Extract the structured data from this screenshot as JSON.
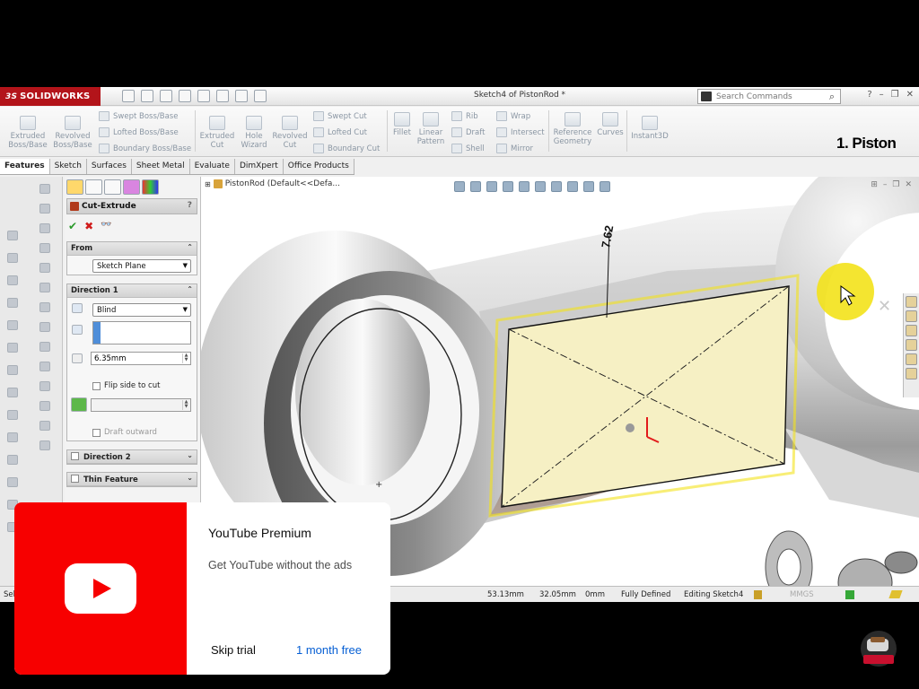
{
  "app": {
    "brand": "SOLIDWORKS",
    "brand_prefix": "3S",
    "document_title": "Sketch4 of PistonRod *",
    "search_placeholder": "Search Commands"
  },
  "ribbon": {
    "buttons": [
      {
        "label": "Extruded Boss/Base"
      },
      {
        "label": "Revolved Boss/Base"
      },
      {
        "label": "Extruded Cut"
      },
      {
        "label": "Hole Wizard"
      },
      {
        "label": "Revolved Cut"
      },
      {
        "label": "Fillet"
      },
      {
        "label": "Linear Pattern"
      },
      {
        "label": "Reference Geometry"
      },
      {
        "label": "Curves"
      },
      {
        "label": "Instant3D"
      }
    ],
    "small": [
      {
        "label": "Swept Boss/Base"
      },
      {
        "label": "Lofted Boss/Base"
      },
      {
        "label": "Boundary Boss/Base"
      },
      {
        "label": "Swept Cut"
      },
      {
        "label": "Lofted Cut"
      },
      {
        "label": "Boundary Cut"
      },
      {
        "label": "Rib"
      },
      {
        "label": "Draft"
      },
      {
        "label": "Shell"
      },
      {
        "label": "Wrap"
      },
      {
        "label": "Intersect"
      },
      {
        "label": "Mirror"
      }
    ],
    "overlay_title": "1. Piston"
  },
  "tabs": [
    "Features",
    "Sketch",
    "Surfaces",
    "Sheet Metal",
    "Evaluate",
    "DimXpert",
    "Office Products"
  ],
  "property_manager": {
    "title": "Cut-Extrude",
    "help": "?",
    "from": {
      "header": "From",
      "value": "Sketch Plane"
    },
    "direction1": {
      "header": "Direction 1",
      "end_condition": "Blind",
      "depth": "6.35mm",
      "flip_side": "Flip side to cut",
      "draft_outward": "Draft outward"
    },
    "direction2": {
      "header": "Direction 2"
    },
    "thin_feature": {
      "header": "Thin Feature"
    }
  },
  "viewport": {
    "tree_label": "PistonRod  (Default<<Defa...",
    "dimension": "7.62"
  },
  "statusbar": {
    "left": "Sel",
    "x": "53.13mm",
    "y": "32.05mm",
    "z": "0mm",
    "state": "Fully Defined",
    "mode": "Editing Sketch4",
    "units": "MMGS"
  },
  "youtube_ad": {
    "title": "YouTube Premium",
    "subtitle": "Get YouTube without the ads",
    "skip": "Skip trial",
    "cta": "1 month free"
  },
  "colors": {
    "solidworks_red": "#b3141a",
    "youtube_red": "#f70000",
    "link_blue": "#065fd4",
    "sketch_face": "#f6f0c4",
    "cursor_highlight": "#f3e21a"
  }
}
